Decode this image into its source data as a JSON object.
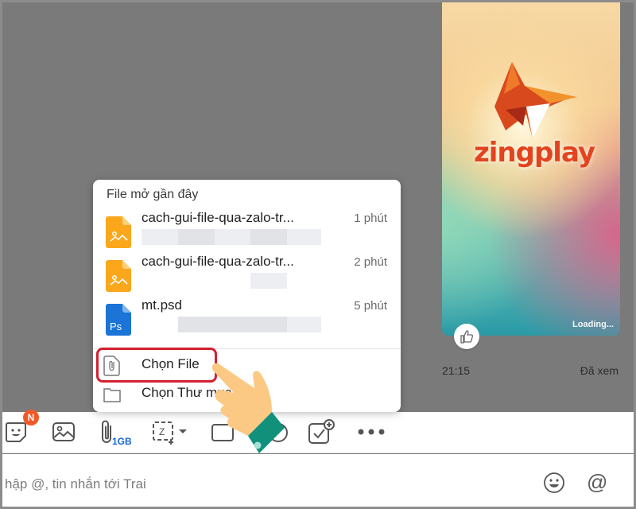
{
  "chat": {
    "image_message": {
      "brand_text": "zingplay",
      "status_text": "Loading..."
    },
    "time": "21:15",
    "seen_status": "Đã xem"
  },
  "recent_files_popup": {
    "title": "File mở gần đây",
    "files": [
      {
        "name": "cach-gui-file-qua-zalo-tr...",
        "time": "1 phút",
        "icon": "image-file-icon",
        "color": "#fba71b"
      },
      {
        "name": "cach-gui-file-qua-zalo-tr...",
        "time": "2 phút",
        "icon": "image-file-icon",
        "color": "#fba71b"
      },
      {
        "name": "mt.psd",
        "time": "5 phút",
        "icon": "photoshop-file-icon",
        "color": "#1b74d6",
        "icon_text": "Ps"
      }
    ],
    "actions": [
      {
        "label": "Chọn File",
        "icon": "paperclip-file-icon",
        "highlighted": true
      },
      {
        "label": "Chọn Thư mục",
        "icon": "folder-icon"
      }
    ]
  },
  "toolbar": {
    "sticker_badge": "N",
    "attach_limit": "1GB",
    "items": [
      "sticker",
      "image",
      "attach-file",
      "screenshot",
      "business-card",
      "reminder",
      "todo",
      "more"
    ]
  },
  "composer": {
    "placeholder": "hập @, tin nhắn tới Trai"
  },
  "colors": {
    "highlight": "#d3202f",
    "badge": "#f05a28",
    "accent_blue": "#1565d8",
    "overlay": "#7a7a7a"
  }
}
